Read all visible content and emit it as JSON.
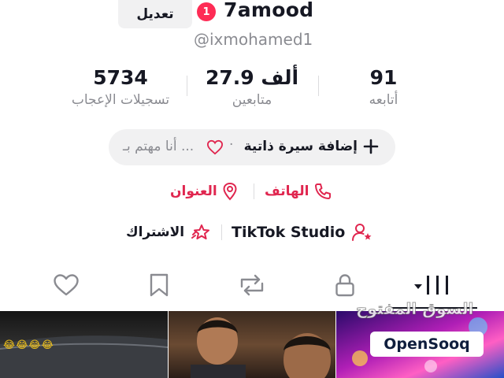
{
  "header": {
    "edit_label": "تعديل",
    "notification_count": "1",
    "display_name": "7amood",
    "username": "@ixmohamed1"
  },
  "stats": {
    "following": {
      "value": "91",
      "label": "أتابعه"
    },
    "followers": {
      "value": "27.9 ألف",
      "label": "متابعين"
    },
    "likes": {
      "value": "5734",
      "label": "تسجيلات الإعجاب"
    }
  },
  "bio": {
    "add_label": "إضافة سيرة ذاتية",
    "separator": "·",
    "interest_placeholder": "أنا مهتم بـ ..."
  },
  "links": {
    "phone_label": "الهاتف",
    "address_label": "العنوان",
    "studio_label": "TikTok Studio",
    "subscribe_label": "الاشتراك"
  },
  "tabs": [
    {
      "name": "videos",
      "icon": "grid-icon",
      "active": true
    },
    {
      "name": "private",
      "icon": "lock-icon",
      "active": false
    },
    {
      "name": "reposts",
      "icon": "repost-icon",
      "active": false
    },
    {
      "name": "saved",
      "icon": "bookmark-icon",
      "active": false
    },
    {
      "name": "liked",
      "icon": "heart-icon",
      "active": false
    }
  ],
  "grid": {
    "thumb_1_overlay": "😂😂😂😂",
    "watermark_text": "السوق المفتوح",
    "watermark_brand": "OpenSooq"
  },
  "colors": {
    "accent": "#fe2c55",
    "link": "#e0264f",
    "text_primary": "#161823",
    "text_secondary": "#8a8b91",
    "pill_bg": "#f1f1f2"
  }
}
